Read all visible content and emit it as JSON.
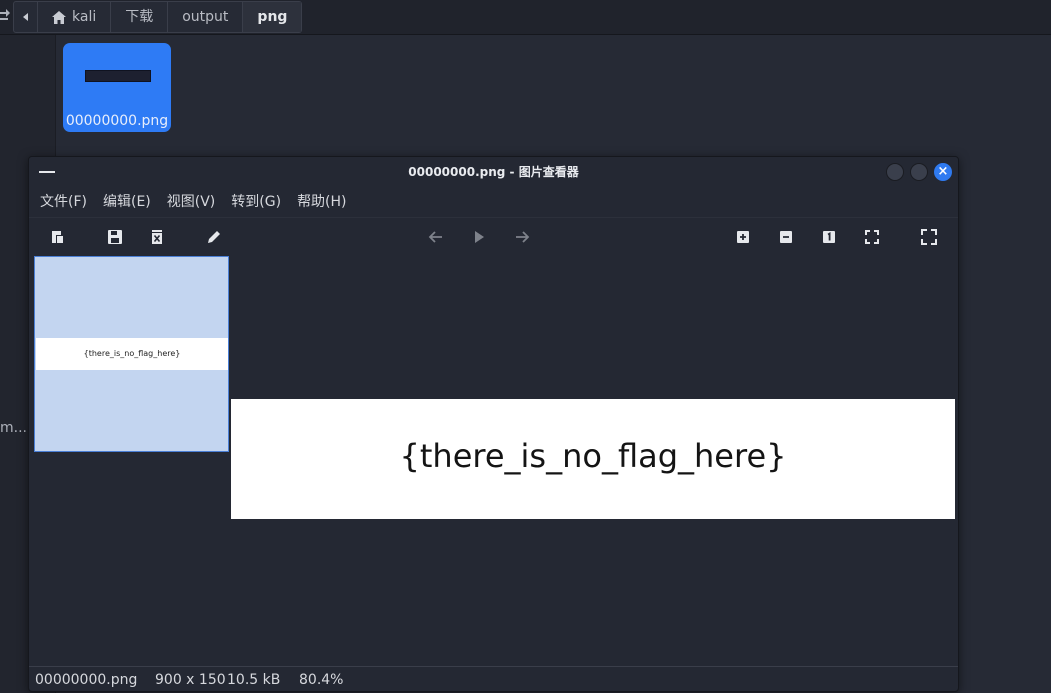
{
  "file_manager": {
    "breadcrumbs": [
      "kali",
      "下载",
      "output",
      "png"
    ],
    "sidebar_partial_text": "m...",
    "file": {
      "name": "00000000.png"
    }
  },
  "viewer": {
    "title": "00000000.png - 图片查看器",
    "menu": [
      "文件(F)",
      "编辑(E)",
      "视图(V)",
      "转到(G)",
      "帮助(H)"
    ],
    "image_text": "{there_is_no_flag_here}",
    "status": {
      "filename": "00000000.png",
      "dimensions": "900 x 150",
      "size": "10.5 kB",
      "zoom": "80.4%"
    }
  },
  "colors": {
    "accent": "#2e7bf5",
    "window_bg": "#242833",
    "thumb_selected": "#c3d5f0"
  }
}
